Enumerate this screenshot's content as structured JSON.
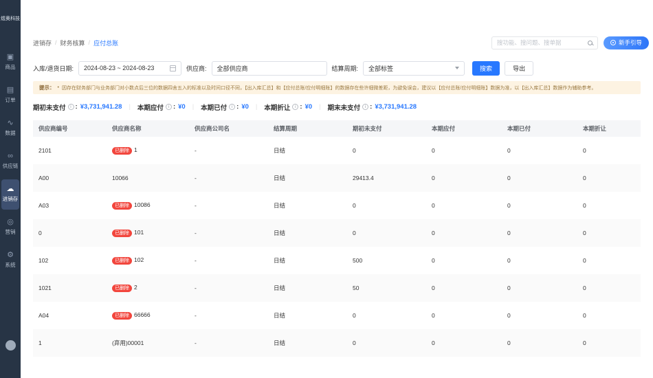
{
  "app": {
    "logo": "煜奥科技"
  },
  "colors": {
    "accent": "#2878ff",
    "badge_red": "#f2463d",
    "sidebar_bg": "#273445",
    "notice_bg": "#fdf3e2"
  },
  "sidebar": {
    "items": [
      {
        "key": "goods",
        "label": "商品",
        "icon": "cube-icon",
        "active": false
      },
      {
        "key": "orders",
        "label": "订单",
        "icon": "order-icon",
        "active": false
      },
      {
        "key": "data",
        "label": "数据",
        "icon": "chart-icon",
        "active": false
      },
      {
        "key": "supply-chain",
        "label": "供应链",
        "icon": "link-icon",
        "active": false
      },
      {
        "key": "inventory",
        "label": "进销存",
        "icon": "inventory-icon",
        "active": true
      },
      {
        "key": "marketing",
        "label": "营销",
        "icon": "tag-icon",
        "active": false
      },
      {
        "key": "system",
        "label": "系统",
        "icon": "gear-icon",
        "active": false
      }
    ]
  },
  "header": {
    "breadcrumb": [
      "进销存",
      "财务核算",
      "应付总账"
    ],
    "search_placeholder": "搜功能、搜问题、搜单据",
    "guide_button": "新手引导"
  },
  "filters": {
    "date_label": "入库/退货日期:",
    "date_value": "2024-08-23 ~ 2024-08-23",
    "supplier_label": "供应商:",
    "supplier_value": "全部供应商",
    "cycle_label": "结算周期:",
    "cycle_value": "全部标签",
    "search_button": "搜索",
    "export_button": "导出"
  },
  "notice": {
    "prefix": "提示：",
    "bullet": "•",
    "text": "因存在财务部门与业务部门对小数点后三位的数据四舍五入的标准以及时间口径不同，【出入库汇总】和【应付总账/应付明细账】的数据存在些许细微差距，为避免误会，建议以【应付总账/应付明细账】数据为准，以【出入库汇总】数据作为辅助参考。"
  },
  "summary": {
    "items": [
      {
        "label": "期初未支付",
        "value": "¥3,731,941.28"
      },
      {
        "label": "本期应付",
        "value": "¥0"
      },
      {
        "label": "本期已付",
        "value": "¥0"
      },
      {
        "label": "本期折让",
        "value": "¥0"
      },
      {
        "label": "期末未支付",
        "value": "¥3,731,941.28"
      }
    ]
  },
  "table": {
    "deleted_badge": "已删除",
    "columns": [
      "供应商编号",
      "供应商名称",
      "供应商公司名",
      "结算周期",
      "期初未支付",
      "本期应付",
      "本期已付",
      "本期折让"
    ],
    "rows": [
      {
        "code": "2101",
        "deleted": true,
        "name": "1",
        "company": "-",
        "cycle": "日结",
        "opening": "0",
        "payable": "0",
        "paid": "0",
        "discount": "0"
      },
      {
        "code": "A00",
        "deleted": false,
        "name": "10066",
        "company": "-",
        "cycle": "日结",
        "opening": "29413.4",
        "payable": "0",
        "paid": "0",
        "discount": "0"
      },
      {
        "code": "A03",
        "deleted": true,
        "name": "10086",
        "company": "-",
        "cycle": "日结",
        "opening": "0",
        "payable": "0",
        "paid": "0",
        "discount": "0"
      },
      {
        "code": "0",
        "deleted": true,
        "name": "101",
        "company": "-",
        "cycle": "日结",
        "opening": "0",
        "payable": "0",
        "paid": "0",
        "discount": "0"
      },
      {
        "code": "102",
        "deleted": true,
        "name": "102",
        "company": "-",
        "cycle": "日结",
        "opening": "500",
        "payable": "0",
        "paid": "0",
        "discount": "0"
      },
      {
        "code": "1021",
        "deleted": true,
        "name": "2",
        "company": "-",
        "cycle": "日结",
        "opening": "50",
        "payable": "0",
        "paid": "0",
        "discount": "0"
      },
      {
        "code": "A04",
        "deleted": true,
        "name": "66666",
        "company": "-",
        "cycle": "日结",
        "opening": "0",
        "payable": "0",
        "paid": "0",
        "discount": "0"
      },
      {
        "code": "1",
        "deleted": false,
        "name": "(弃用)00001",
        "company": "-",
        "cycle": "日结",
        "opening": "0",
        "payable": "0",
        "paid": "0",
        "discount": "0"
      }
    ]
  }
}
